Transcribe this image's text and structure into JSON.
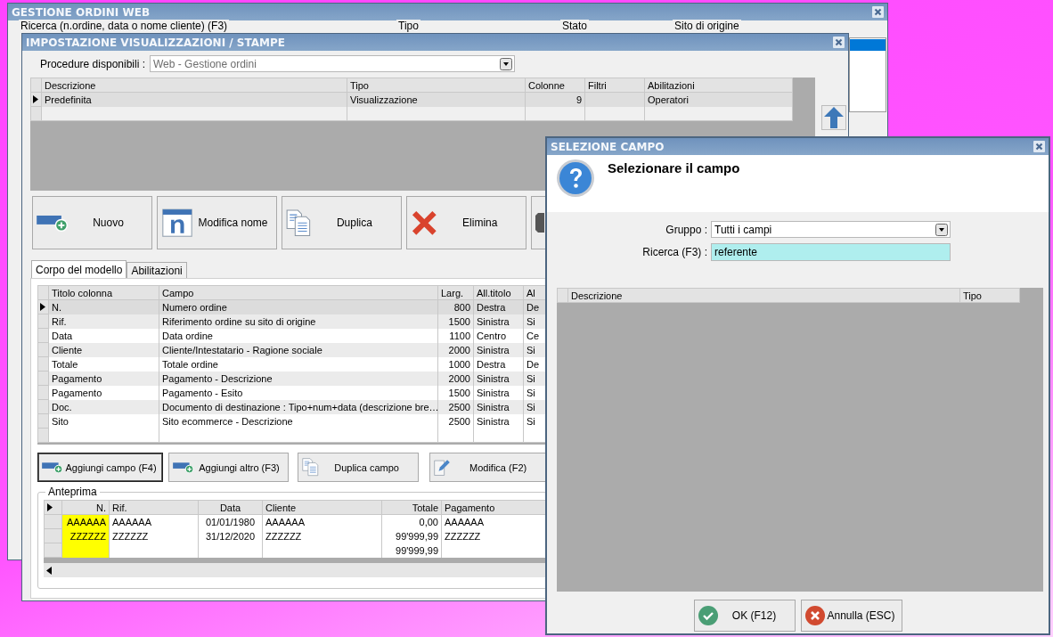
{
  "main_window": {
    "title": "GESTIONE ORDINI WEB",
    "filters": [
      {
        "label": "Ricerca (n.ordine, data o nome cliente) (F3)"
      },
      {
        "label": "Tipo"
      },
      {
        "label": "Stato"
      },
      {
        "label": "Sito di origine"
      }
    ]
  },
  "settings_window": {
    "title": "IMPOSTAZIONE VISUALIZZAZIONI / STAMPE",
    "procedure": {
      "label": "Procedure disponibili :",
      "value": "Web - Gestione ordini"
    },
    "models": {
      "columns": [
        "Descrizione",
        "Tipo",
        "Colonne",
        "Filtri",
        "Abilitazioni"
      ],
      "rows": [
        {
          "cells": [
            "Predefinita",
            "Visualizzazione",
            "9",
            "",
            "Operatori"
          ],
          "selected": true
        }
      ]
    },
    "actions": [
      {
        "kind": "new",
        "label": "Nuovo"
      },
      {
        "kind": "rename",
        "label": "Modifica nome"
      },
      {
        "kind": "duplicate",
        "label": "Duplica"
      },
      {
        "kind": "delete",
        "label": "Elimina"
      },
      {
        "kind": "other"
      }
    ],
    "tabs": [
      {
        "label": "Corpo del modello",
        "selected": true
      },
      {
        "label": "Abilitazioni",
        "selected": false
      }
    ],
    "fields": {
      "columns": [
        "Titolo colonna",
        "Campo",
        "Larg.",
        "All.titolo",
        "Al"
      ],
      "rows": [
        {
          "cells": [
            "N.",
            "Numero ordine",
            "800",
            "Destra",
            "De"
          ],
          "selected": true
        },
        {
          "cells": [
            "Rif.",
            "Riferimento ordine su sito di origine",
            "1500",
            "Sinistra",
            "Si"
          ],
          "selected": false
        },
        {
          "cells": [
            "Data",
            "Data ordine",
            "1100",
            "Centro",
            "Ce"
          ],
          "selected": false
        },
        {
          "cells": [
            "Cliente",
            "Cliente/Intestatario - Ragione sociale",
            "2000",
            "Sinistra",
            "Si"
          ],
          "selected": false
        },
        {
          "cells": [
            "Totale",
            "Totale ordine",
            "1000",
            "Destra",
            "De"
          ],
          "selected": false
        },
        {
          "cells": [
            "Pagamento",
            "Pagamento - Descrizione",
            "2000",
            "Sinistra",
            "Si"
          ],
          "selected": false
        },
        {
          "cells": [
            "Pagamento",
            "Pagamento - Esito",
            "1500",
            "Sinistra",
            "Si"
          ],
          "selected": false
        },
        {
          "cells": [
            "Doc.",
            "Documento di destinazione : Tipo+num+data (descrizione bre…",
            "2500",
            "Sinistra",
            "Si"
          ],
          "selected": false
        },
        {
          "cells": [
            "Sito",
            "Sito ecommerce - Descrizione",
            "2500",
            "Sinistra",
            "Si"
          ],
          "selected": false
        }
      ]
    },
    "field_actions": [
      {
        "kind": "add",
        "label": "Aggiungi campo (F4)",
        "focused": true
      },
      {
        "kind": "add",
        "label": "Aggiungi altro (F3)",
        "focused": false
      },
      {
        "kind": "duplicate",
        "label": "Duplica campo",
        "focused": false
      },
      {
        "kind": "edit",
        "label": "Modifica (F2)",
        "focused": false
      }
    ],
    "preview": {
      "title": "Anteprima",
      "columns": [
        {
          "label": "N.",
          "highlighted": true
        },
        {
          "label": "Rif.",
          "highlighted": false
        },
        {
          "label": "Data",
          "highlighted": false
        },
        {
          "label": "Cliente",
          "highlighted": false
        },
        {
          "label": "Totale",
          "highlighted": false
        },
        {
          "label": "Pagamento",
          "highlighted": false
        }
      ],
      "rows": [
        [
          "AAAAAA",
          "AAAAAA",
          "01/01/1980",
          "AAAAAA",
          "0,00",
          "AAAAAA"
        ],
        [
          "ZZZZZZ",
          "ZZZZZZ",
          "31/12/2020",
          "ZZZZZZ",
          "99'999,99",
          "ZZZZZZ"
        ],
        [
          "",
          "",
          "",
          "",
          "99'999,99",
          ""
        ]
      ]
    }
  },
  "select_dialog": {
    "title": "SELEZIONE CAMPO",
    "heading": "Selezionare il campo",
    "group": {
      "label": "Gruppo :",
      "value": "Tutti i campi"
    },
    "search": {
      "label": "Ricerca (F3) :",
      "value": "referente"
    },
    "columns": [
      "Descrizione",
      "Tipo"
    ],
    "buttons": [
      {
        "kind": "ok",
        "label": "OK (F12)"
      },
      {
        "kind": "cancel",
        "label": "Annulla (ESC)"
      }
    ]
  }
}
